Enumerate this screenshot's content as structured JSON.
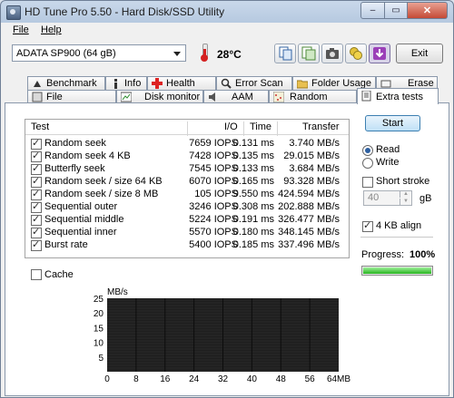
{
  "window": {
    "title": "HD Tune Pro 5.50 - Hard Disk/SSD Utility",
    "buttons": {
      "minimize": "–",
      "maximize": "▭",
      "close": "✕"
    }
  },
  "menu": {
    "file": "File",
    "help": "Help"
  },
  "toolbar": {
    "drive": "ADATA SP900 (64 gB)",
    "temperature": "28°C",
    "exit_label": "Exit",
    "icons": [
      "copy-icon",
      "save-icon",
      "camera-icon",
      "coins-icon",
      "download-icon"
    ]
  },
  "tabs": {
    "row1": [
      "Benchmark",
      "Info",
      "Health",
      "Error Scan",
      "Folder Usage",
      "Erase"
    ],
    "row2": [
      "File Benchmark",
      "Disk monitor",
      "AAM",
      "Random Access",
      "Extra tests"
    ],
    "selected": "Extra tests"
  },
  "results": {
    "headers": {
      "test": "Test",
      "io": "I/O",
      "time": "Time",
      "transfer": "Transfer"
    },
    "rows": [
      {
        "name": "Random seek",
        "io": "7659 IOPS",
        "time": "0.131 ms",
        "transfer": "3.740 MB/s"
      },
      {
        "name": "Random seek 4 KB",
        "io": "7428 IOPS",
        "time": "0.135 ms",
        "transfer": "29.015 MB/s"
      },
      {
        "name": "Butterfly seek",
        "io": "7545 IOPS",
        "time": "0.133 ms",
        "transfer": "3.684 MB/s"
      },
      {
        "name": "Random seek / size 64 KB",
        "io": "6070 IOPS",
        "time": "0.165 ms",
        "transfer": "93.328 MB/s"
      },
      {
        "name": "Random seek / size 8 MB",
        "io": "105 IOPS",
        "time": "9.550 ms",
        "transfer": "424.594 MB/s"
      },
      {
        "name": "Sequential outer",
        "io": "3246 IOPS",
        "time": "0.308 ms",
        "transfer": "202.888 MB/s"
      },
      {
        "name": "Sequential middle",
        "io": "5224 IOPS",
        "time": "0.191 ms",
        "transfer": "326.477 MB/s"
      },
      {
        "name": "Sequential inner",
        "io": "5570 IOPS",
        "time": "0.180 ms",
        "transfer": "348.145 MB/s"
      },
      {
        "name": "Burst rate",
        "io": "5400 IOPS",
        "time": "0.185 ms",
        "transfer": "337.496 MB/s"
      }
    ]
  },
  "controls": {
    "start_label": "Start",
    "read_label": "Read",
    "write_label": "Write",
    "mode": "Read",
    "short_stroke_label": "Short stroke",
    "short_stroke_checked": false,
    "short_stroke_value": "40",
    "short_stroke_unit": "gB",
    "align_label": "4 KB align",
    "align_checked": true,
    "progress_label": "Progress:",
    "progress_value": "100%",
    "progress_fraction": 1.0,
    "cache_label": "Cache",
    "cache_checked": false
  },
  "chart_data": {
    "type": "line",
    "ylabel": "MB/s",
    "yticks": [
      "25",
      "20",
      "15",
      "10",
      "5"
    ],
    "xticks": [
      "0",
      "8",
      "16",
      "24",
      "32",
      "40",
      "48",
      "56",
      "64MB"
    ],
    "ylim": [
      0,
      25
    ],
    "xlim": [
      0,
      64
    ],
    "series": []
  },
  "colors": {
    "progress": "#27b41f",
    "graph_bg": "#1e1e1e",
    "temperature": "#d42020"
  }
}
